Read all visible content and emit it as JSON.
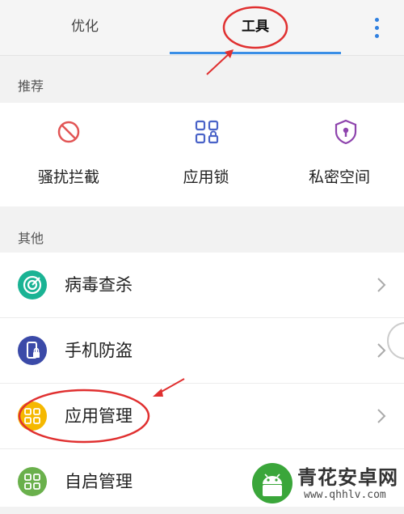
{
  "tabs": [
    {
      "label": "优化",
      "active": false
    },
    {
      "label": "工具",
      "active": true
    }
  ],
  "recommend": {
    "header": "推荐",
    "items": [
      {
        "label": "骚扰拦截",
        "icon": "block-icon"
      },
      {
        "label": "应用锁",
        "icon": "app-lock-icon"
      },
      {
        "label": "私密空间",
        "icon": "private-shield-icon"
      }
    ]
  },
  "other": {
    "header": "其他",
    "items": [
      {
        "label": "病毒查杀",
        "icon": "virus-scan-icon",
        "color": "#1ab394"
      },
      {
        "label": "手机防盗",
        "icon": "phone-antitheft-icon",
        "color": "#3b4aa8"
      },
      {
        "label": "应用管理",
        "icon": "app-manager-icon",
        "color": "#f5b800"
      },
      {
        "label": "自启管理",
        "icon": "autostart-icon",
        "color": "#6ab04c"
      }
    ]
  },
  "colors": {
    "accent": "#3a8ee6",
    "annotation": "#e03030",
    "quick_icon_red": "#e25555",
    "quick_icon_blue": "#4a63c8",
    "quick_icon_purple": "#8e44ad"
  },
  "watermark": {
    "brand": "青花安卓网",
    "url": "www.qhhlv.com"
  }
}
